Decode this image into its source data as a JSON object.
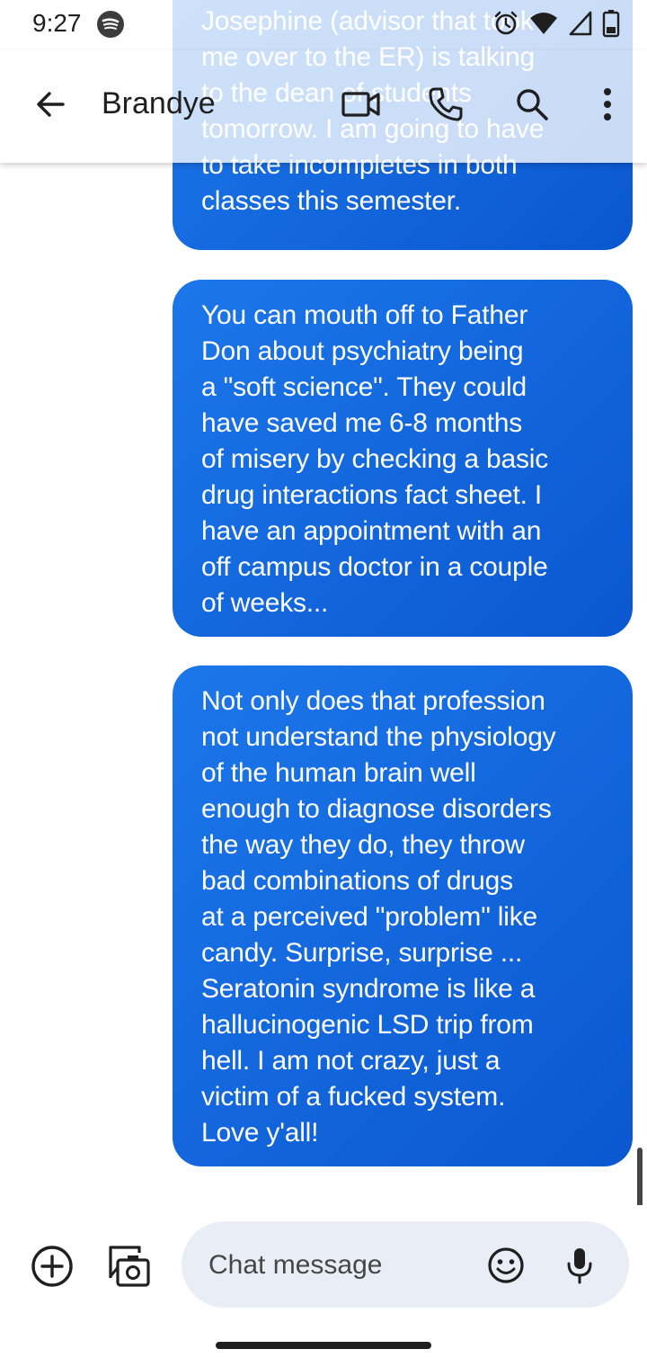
{
  "status_bar": {
    "time": "9:27",
    "icons": [
      "spotify-icon",
      "alarm-icon",
      "wifi-icon",
      "signal-icon",
      "battery-icon"
    ]
  },
  "header": {
    "contact_name": "Brandye",
    "actions": [
      "back-arrow-icon",
      "video-call-icon",
      "phone-icon",
      "search-icon",
      "more-vert-icon"
    ]
  },
  "messages": [
    {
      "direction": "outgoing",
      "text": "Josephine (advisor that took\nme over to the ER) is talking\nto the dean of students\ntomorrow. I am going to have\nto take incompletes in both\nclasses this semester."
    },
    {
      "direction": "outgoing",
      "text": "You can mouth off to Father\nDon about psychiatry being\na \"soft science\". They could\nhave saved me 6-8 months\nof misery by checking a basic\ndrug interactions fact sheet. I\nhave an appointment with an\noff campus doctor in a couple\nof weeks..."
    },
    {
      "direction": "outgoing",
      "text": "Not only does that profession\nnot understand the physiology\nof the human brain well\nenough to diagnose disorders\nthe way they do, they throw\nbad combinations of drugs\nat a perceived \"problem\" like\ncandy. Surprise, surprise ...\nSeratonin syndrome is like a\nhallucinogenic LSD trip from\nhell. I am not crazy, just a\nvictim of a fucked system.\nLove y'all!"
    }
  ],
  "compose": {
    "placeholder": "Chat message",
    "value": ""
  },
  "colors": {
    "bubble_start": "#1c77ea",
    "bubble_end": "#0b57d0",
    "compose_bg": "#e9eef6",
    "text_primary": "#1f1f1f"
  }
}
